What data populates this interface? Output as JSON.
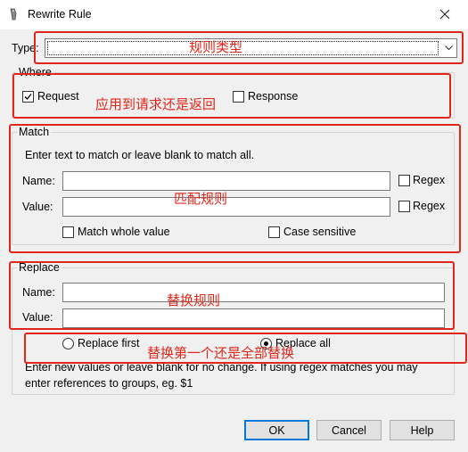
{
  "window": {
    "title": "Rewrite Rule"
  },
  "type": {
    "label": "Type:",
    "value": ""
  },
  "where": {
    "title": "Where",
    "request_label": "Request",
    "request_checked": true,
    "response_label": "Response",
    "response_checked": false
  },
  "match": {
    "title": "Match",
    "hint": "Enter text to match or leave blank to match all.",
    "name_label": "Name:",
    "name_value": "",
    "value_label": "Value:",
    "value_value": "",
    "regex_label": "Regex",
    "match_whole_label": "Match whole value",
    "case_sensitive_label": "Case sensitive"
  },
  "replace": {
    "title": "Replace",
    "name_label": "Name:",
    "name_value": "",
    "value_label": "Value:",
    "value_value": "",
    "replace_first_label": "Replace first",
    "replace_all_label": "Replace all",
    "selected": "Replace all",
    "help_line1": "Enter new values or leave blank for no change. If using regex matches you may",
    "help_line2": "enter references to groups, eg. $1"
  },
  "buttons": {
    "ok": "OK",
    "cancel": "Cancel",
    "help": "Help"
  },
  "annotations": {
    "type": "规则类型",
    "where": "应用到请求还是返回",
    "match": "匹配规则",
    "replace": "替换规则",
    "replace_mode": "替换第一个还是全部替换"
  },
  "colors": {
    "annotation": "#e0261b",
    "default_button_border": "#0078d7"
  }
}
